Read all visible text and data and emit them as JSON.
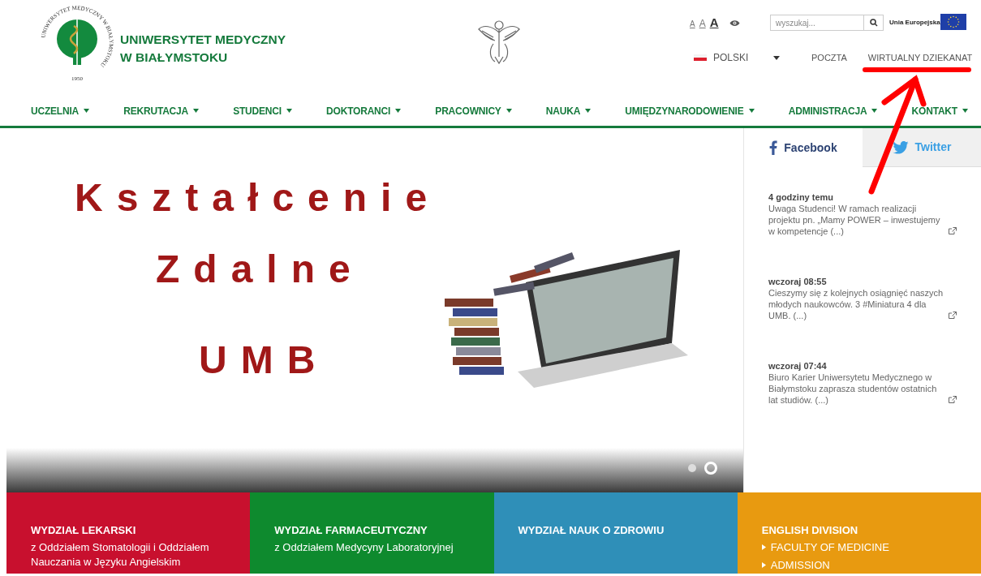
{
  "header": {
    "name_line_1": "UNIWERSYTET MEDYCZNY",
    "name_line_2": "W BIAŁYMSTOKU",
    "logo_ring_text": "UNIWERSYTET MEDYCZNY W BIAŁYMSTOKU",
    "logo_year": "1950",
    "font_sizes": [
      {
        "label": "A",
        "selected": false
      },
      {
        "label": "A",
        "selected": false
      },
      {
        "label": "A",
        "selected": true
      }
    ],
    "search": {
      "placeholder": "wyszukaj..."
    },
    "eu_label": "Unia Europejska",
    "language": "POLSKI",
    "links": [
      "POCZTA",
      "WIRTUALNY DZIEKANAT"
    ]
  },
  "nav": [
    "UCZELNIA",
    "REKRUTACJA",
    "STUDENCI",
    "DOKTORANCI",
    "PRACOWNICY",
    "NAUKA",
    "UMIĘDZYNARODOWIENIE",
    "ADMINISTRACJA",
    "KONTAKT"
  ],
  "slider": {
    "lines": [
      "Kształcenie",
      "Zdalne",
      "UMB"
    ],
    "dots": [
      {
        "selected": false
      },
      {
        "selected": true
      }
    ]
  },
  "social": {
    "tabs": [
      {
        "label": "Facebook",
        "selected": true
      },
      {
        "label": "Twitter",
        "selected": false
      }
    ],
    "posts": [
      {
        "time": "4 godziny temu",
        "text": "Uwaga Studenci! W ramach realizacji projektu pn. „Mamy POWER – inwestujemy w kompetencje (...)"
      },
      {
        "time": "wczoraj 08:55",
        "text": "Cieszymy się z kolejnych osiągnięć naszych młodych naukowców. 3 #Miniatura 4 dla UMB. (...)"
      },
      {
        "time": "wczoraj 07:44",
        "text": "Biuro Karier Uniwersytetu Medycznego w Białymstoku zaprasza studentów ostatnich lat studiów. (...)"
      }
    ]
  },
  "faculties": [
    {
      "title": "WYDZIAŁ LEKARSKI",
      "color": "#c8102e",
      "lines": [
        "z Oddziałem Stomatologii  i Oddziałem Nauczania w Języku Angielskim"
      ]
    },
    {
      "title": "WYDZIAŁ FARMACEUTYCZNY",
      "color": "#0e8a2e",
      "lines": [
        "z Oddziałem Medycyny Laboratoryjnej"
      ]
    },
    {
      "title": "WYDZIAŁ NAUK O ZDROWIU",
      "color": "#2f8fb8"
    },
    {
      "title": "ENGLISH DIVISION",
      "color": "#e89a10",
      "links": [
        "FACULTY OF MEDICINE",
        "ADMISSION"
      ]
    }
  ]
}
